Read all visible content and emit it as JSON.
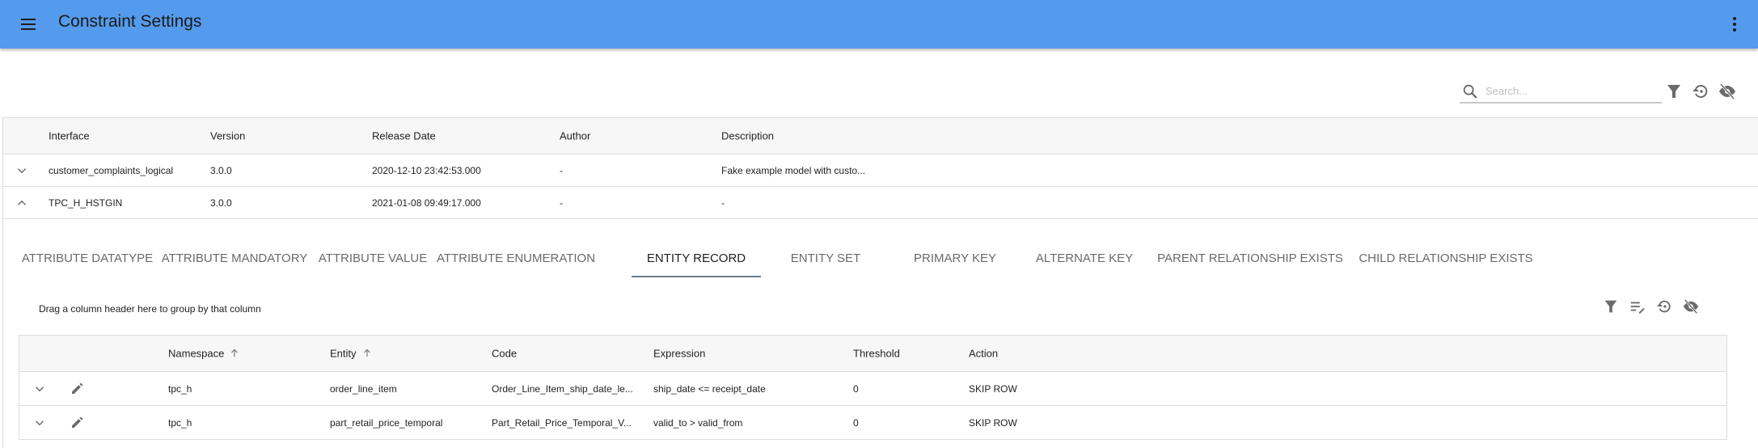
{
  "appbar": {
    "title": "Constraint Settings",
    "menu_icon": "hamburger-menu-icon",
    "more_icon": "more-vertical-icon",
    "color": "#559bed"
  },
  "toolbar": {
    "search_placeholder": "Search...",
    "search_value": "",
    "icons": [
      "search-icon",
      "filter-icon",
      "reset-icon",
      "hide-columns-icon"
    ]
  },
  "interfaces": {
    "columns": [
      "Interface",
      "Version",
      "Release Date",
      "Author",
      "Description"
    ],
    "rows": [
      {
        "expanded": false,
        "interface": "customer_complaints_logical",
        "version": "3.0.0",
        "release_date": "2020-12-10 23:42:53.000",
        "author": "-",
        "description": "Fake example model with custo..."
      },
      {
        "expanded": true,
        "interface": "TPC_H_HSTGIN",
        "version": "3.0.0",
        "release_date": "2021-01-08 09:49:17.000",
        "author": "-",
        "description": "-"
      }
    ]
  },
  "detail": {
    "tabs": [
      {
        "label": "ATTRIBUTE DATATYPE",
        "active": false
      },
      {
        "label": "ATTRIBUTE MANDATORY",
        "active": false
      },
      {
        "label": "ATTRIBUTE VALUE",
        "active": false
      },
      {
        "label": "ATTRIBUTE ENUMERATION",
        "active": false
      },
      {
        "label": "ENTITY RECORD",
        "active": true
      },
      {
        "label": "ENTITY SET",
        "active": false
      },
      {
        "label": "PRIMARY KEY",
        "active": false
      },
      {
        "label": "ALTERNATE KEY",
        "active": false
      },
      {
        "label": "PARENT RELATIONSHIP EXISTS",
        "active": false
      },
      {
        "label": "CHILD RELATIONSHIP EXISTS",
        "active": false
      }
    ],
    "group_hint": "Drag a column header here to group by that column",
    "toolbar_icons": [
      "filter-icon",
      "edit-list-icon",
      "reset-icon",
      "hide-columns-icon"
    ],
    "columns": {
      "namespace": "Namespace",
      "entity": "Entity",
      "code": "Code",
      "expression": "Expression",
      "threshold": "Threshold",
      "action": "Action"
    },
    "sorted_columns": [
      "Namespace",
      "Entity"
    ],
    "rows": [
      {
        "namespace": "tpc_h",
        "entity": "order_line_item",
        "code": "Order_Line_Item_ship_date_le...",
        "expression": "ship_date <= receipt_date",
        "threshold": "0",
        "action": "SKIP ROW"
      },
      {
        "namespace": "tpc_h",
        "entity": "part_retail_price_temporal",
        "code": "Part_Retail_Price_Temporal_V...",
        "expression": "valid_to > valid_from",
        "threshold": "0",
        "action": "SKIP ROW"
      }
    ]
  }
}
